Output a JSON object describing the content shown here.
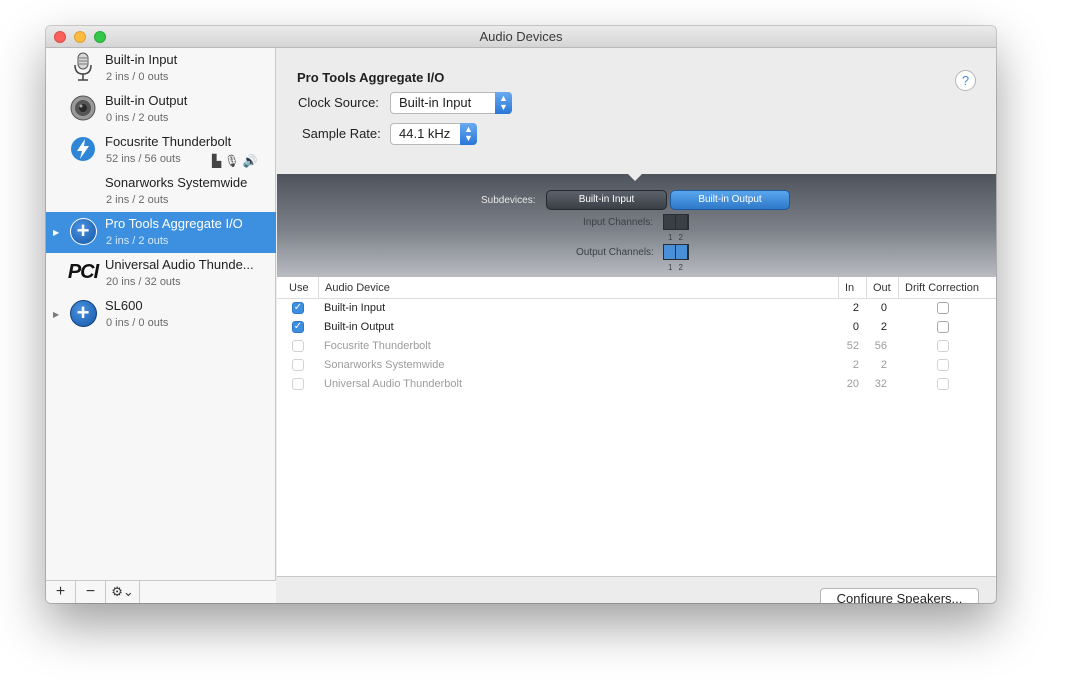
{
  "window": {
    "title": "Audio Devices"
  },
  "sidebar": {
    "devices": [
      {
        "name": "Built-in Input",
        "sub": "2 ins / 0 outs",
        "icon": "microphone-icon"
      },
      {
        "name": "Built-in Output",
        "sub": "0 ins / 2 outs",
        "icon": "speaker-icon"
      },
      {
        "name": "Focusrite Thunderbolt",
        "sub": "52 ins / 56 outs",
        "icon": "thunderbolt-icon"
      },
      {
        "name": "Sonarworks Systemwide",
        "sub": "2 ins / 2 outs",
        "icon": ""
      },
      {
        "name": "Pro Tools Aggregate I/O",
        "sub": "2 ins / 2 outs",
        "icon": "aggregate-plus-icon",
        "selected": true
      },
      {
        "name": "Universal Audio Thunde...",
        "sub": "20 ins / 32 outs",
        "icon": "pci-icon",
        "logo_text": "PCI"
      },
      {
        "name": "SL600",
        "sub": "0 ins / 0 outs",
        "icon": "aggregate-plus-icon"
      }
    ],
    "add_label": "+",
    "remove_label": "−",
    "gear_label": "⚙⌄"
  },
  "main": {
    "device_title": "Pro Tools Aggregate I/O",
    "help_label": "?",
    "clock_source_label": "Clock Source:",
    "clock_source_value": "Built-in Input",
    "sample_rate_label": "Sample Rate:",
    "sample_rate_value": "44.1 kHz",
    "subdevices_label": "Subdevices:",
    "subdevice_in": "Built-in Input",
    "subdevice_out": "Built-in Output",
    "input_channels_label": "Input Channels:",
    "output_channels_label": "Output Channels:",
    "channel_numbers": "12"
  },
  "table": {
    "headers": {
      "use": "Use",
      "device": "Audio Device",
      "in": "In",
      "out": "Out",
      "drift": "Drift Correction"
    },
    "rows": [
      {
        "use": true,
        "device": "Built-in Input",
        "in": "2",
        "out": "0",
        "drift": false,
        "enabled": true
      },
      {
        "use": true,
        "device": "Built-in Output",
        "in": "0",
        "out": "2",
        "drift": false,
        "enabled": true
      },
      {
        "use": false,
        "device": "Focusrite Thunderbolt",
        "in": "52",
        "out": "56",
        "drift": false,
        "enabled": false
      },
      {
        "use": false,
        "device": "Sonarworks Systemwide",
        "in": "2",
        "out": "2",
        "drift": false,
        "enabled": false
      },
      {
        "use": false,
        "device": "Universal Audio Thunderbolt",
        "in": "20",
        "out": "32",
        "drift": false,
        "enabled": false
      }
    ]
  },
  "footer": {
    "configure_label": "Configure Speakers..."
  },
  "colors": {
    "selection": "#3d8fe0",
    "accent": "#2e78c9"
  }
}
